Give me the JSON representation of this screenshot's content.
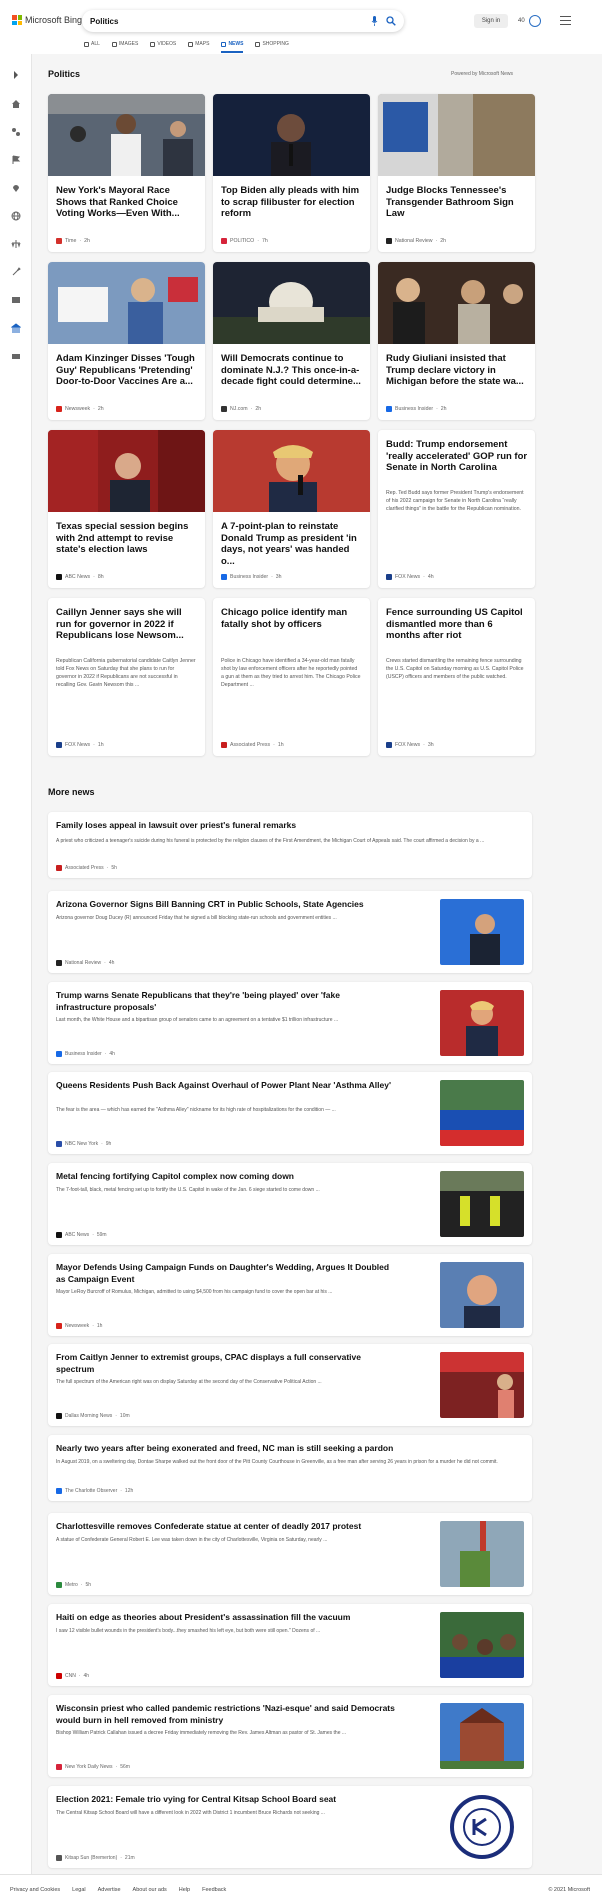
{
  "header": {
    "logo_text": "Microsoft Bing",
    "search_value": "Politics",
    "signin_label": "Sign in",
    "rewards_count": "40",
    "tabs": [
      "ALL",
      "IMAGES",
      "VIDEOS",
      "MAPS",
      "NEWS",
      "SHOPPING"
    ],
    "active_tab": "NEWS"
  },
  "section": {
    "title": "Politics",
    "powered_by": "Powered by Microsoft News"
  },
  "cards": [
    {
      "title": "New York's Mayoral Race Shows that Ranked Choice Voting Works—Even With...",
      "source": "Time",
      "time": "2h",
      "body": ""
    },
    {
      "title": "Top Biden ally pleads with him to scrap filibuster for election reform",
      "source": "POLITICO",
      "time": "7h",
      "body": ""
    },
    {
      "title": "Judge Blocks Tennessee's Transgender Bathroom Sign Law",
      "source": "National Review",
      "time": "2h",
      "body": ""
    },
    {
      "title": "Adam Kinzinger Disses 'Tough Guy' Republicans 'Pretending' Door-to-Door Vaccines Are a...",
      "source": "Newsweek",
      "time": "2h",
      "body": ""
    },
    {
      "title": "Will Democrats continue to dominate N.J.? This once-in-a-decade fight could determine...",
      "source": "NJ.com",
      "time": "2h",
      "body": ""
    },
    {
      "title": "Rudy Giuliani insisted that Trump declare victory in Michigan before the state wa...",
      "source": "Business Insider",
      "time": "2h",
      "body": ""
    },
    {
      "title": "Texas special session begins with 2nd attempt to revise state's election laws",
      "source": "ABC News",
      "time": "8h",
      "body": ""
    },
    {
      "title": "A 7-point-plan to reinstate Donald Trump as president 'in days, not years' was handed o...",
      "source": "Business Insider",
      "time": "3h",
      "body": ""
    },
    {
      "title": "Budd: Trump endorsement 'really accelerated' GOP run for Senate in North Carolina",
      "source": "FOX News",
      "time": "4h",
      "body": "Rep. Ted Budd says former President Trump's endorsement of his 2022 campaign for Senate in North Carolina “really clarified things” in the battle for the Republican nomination."
    },
    {
      "title": "Caillyn Jenner says she will run for governor in 2022 if Republicans lose Newsom...",
      "source": "FOX News",
      "time": "1h",
      "body": "Republican California gubernatorial candidate Caitlyn Jenner told Fox News on Saturday that she plans to run for governor in 2022 if Republicans are not successful in recalling Gov. Gavin Newsom this ..."
    },
    {
      "title": "Chicago police identify man fatally shot by officers",
      "source": "Associated Press",
      "time": "1h",
      "body": "Police in Chicago have identified a 34-year-old man fatally shot by law enforcement officers after he reportedly pointed a gun at them as they tried to arrest him. The Chicago Police Department ..."
    },
    {
      "title": "Fence surrounding US Capitol dismantled more than 6 months after riot",
      "source": "FOX News",
      "time": "3h",
      "body": "Crews started dismantling the remaining fence surrounding the U.S. Capitol on Saturday morning as U.S. Capitol Police (USCP) officers and members of the public watched."
    }
  ],
  "more_news_title": "More news",
  "more_news": [
    {
      "title": "Family loses appeal in lawsuit over priest's funeral remarks",
      "body": "A priest who criticized a teenager's suicide during his funeral is protected by the religion clauses of the First Amendment, the Michigan Court of Appeals said. The court affirmed a decision by a ...",
      "source": "Associated Press",
      "time": "5h"
    },
    {
      "title": "Arizona Governor Signs Bill Banning CRT in Public Schools, State Agencies",
      "body": "Arizona governor Doug Ducey (R) announced Friday that he signed a bill blocking state-run schools and government entities ...",
      "source": "National Review",
      "time": "4h"
    },
    {
      "title": "Trump warns Senate Republicans that they're 'being played' over 'fake infrastructure proposals'",
      "body": "Last month, the White House and a bipartisan group of senators came to an agreement on a tentative $1 trillion infrastructure ...",
      "source": "Business Insider",
      "time": "4h"
    },
    {
      "title": "Queens Residents Push Back Against Overhaul of Power Plant Near 'Asthma Alley'",
      "body": "The fear is the area — which has earned the \"Asthma Alley\" nickname for its high rate of hospitalizations for the condition — ...",
      "source": "NBC New York",
      "time": "9h"
    },
    {
      "title": "Metal fencing fortifying Capitol complex now coming down",
      "body": "The 7-foot-tall, black, metal fencing set up to fortify the U.S. Capitol in wake of the Jan. 6 siege started to come down ...",
      "source": "ABC News",
      "time": "59m"
    },
    {
      "title": "Mayor Defends Using Campaign Funds on Daughter's Wedding, Argues It Doubled as Campaign Event",
      "body": "Mayor LeRoy Burcroff of Romulus, Michigan, admitted to using $4,500 from his campaign fund to cover the open bar at his ...",
      "source": "Newsweek",
      "time": "1h"
    },
    {
      "title": "From Caitlyn Jenner to extremist groups, CPAC displays a full conservative spectrum",
      "body": "The full spectrum of the American right was on display Saturday at the second day of the Conservative Political Action ...",
      "source": "Dallas Morning News",
      "time": "10m"
    },
    {
      "title": "Nearly two years after being exonerated and freed, NC man is still seeking a pardon",
      "body": "In August 2019, on a sweltering day, Dontae Sharpe walked out the front door of the Pitt County Courthouse in Greenville, as a free man after serving 26 years in prison for a murder he did not commit.",
      "source": "The Charlotte Observer",
      "time": "12h"
    },
    {
      "title": "Charlottesville removes Confederate statue at center of deadly 2017 protest",
      "body": "A statue of Confederate General Robert E. Lee was taken down in the city of Charlottesville, Virginia on Saturday, nearly ...",
      "source": "Metro",
      "time": "5h"
    },
    {
      "title": "Haiti on edge as theories about President's assassination fill the vacuum",
      "body": "I saw 12 visible bullet wounds in the president's body...they smashed his left eye, but both were still open.\" Dozens of ...",
      "source": "CNN",
      "time": "4h"
    },
    {
      "title": "Wisconsin priest who called pandemic restrictions 'Nazi-esque' and said Democrats would burn in hell removed from ministry",
      "body": "Bishop William Patrick Callahan issued a decree Friday immediately removing the Rev. James Altman as pastor of St. James the ...",
      "source": "New York Daily News",
      "time": "56m"
    },
    {
      "title": "Election 2021: Female trio vying for Central Kitsap School Board seat",
      "body": "The Central Kitsap School Board will have a different look in 2022 with District 1 incumbent Bruce Richards not seeking ...",
      "source": "Kitsap Sun (Bremerton)",
      "time": "21m"
    }
  ],
  "footer": {
    "links": [
      "Privacy and Cookies",
      "Legal",
      "Advertise",
      "About our ads",
      "Help",
      "Feedback"
    ],
    "copyright": "© 2021 Microsoft"
  },
  "colors": {
    "accent": "#1a62c1"
  }
}
